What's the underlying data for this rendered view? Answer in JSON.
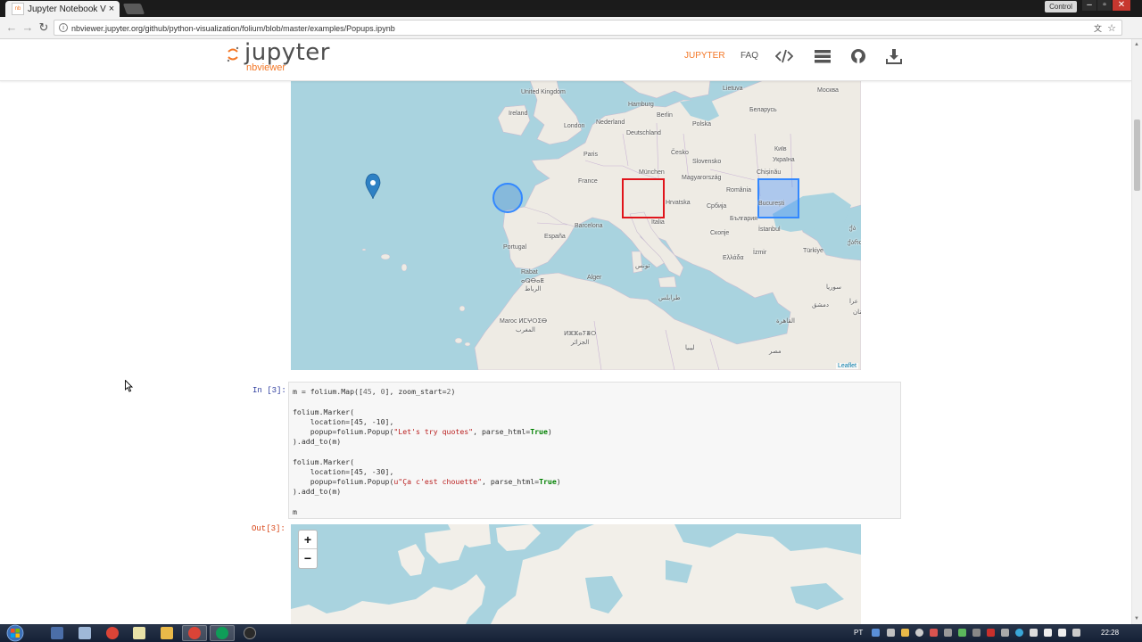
{
  "browser": {
    "tab_title": "Jupyter Notebook Viewer",
    "tab_favicon_text": "nb",
    "tab_close": "×",
    "profile_label": "Control",
    "url": "nbviewer.jupyter.org/github/python-visualization/folium/blob/master/examples/Popups.ipynb",
    "back_icon": "←",
    "forward_icon": "→",
    "reload_icon": "↻",
    "info_icon": "i",
    "translate_icon": "文",
    "star_icon": "☆",
    "win_minimize": "–",
    "win_maximize": "▫",
    "win_close": "✕"
  },
  "header": {
    "logo_word": "jupyter",
    "logo_sub": "nbviewer",
    "nav_jupyter": "JUPYTER",
    "nav_faq": "FAQ"
  },
  "map1": {
    "attribution": "Leaflet",
    "labels": [
      {
        "id": "uk",
        "text": "United Kingdom"
      },
      {
        "id": "ireland",
        "text": "Ireland"
      },
      {
        "id": "london",
        "text": "London"
      },
      {
        "id": "nederland",
        "text": "Nederland"
      },
      {
        "id": "hamburg",
        "text": "Hamburg"
      },
      {
        "id": "berlin",
        "text": "Berlin"
      },
      {
        "id": "polska",
        "text": "Polska"
      },
      {
        "id": "lietuva",
        "text": "Lietuva"
      },
      {
        "id": "belarus",
        "text": "Беларусь"
      },
      {
        "id": "moskva",
        "text": "Москва"
      },
      {
        "id": "deutschland",
        "text": "Deutschland"
      },
      {
        "id": "paris",
        "text": "Paris"
      },
      {
        "id": "cesko",
        "text": "Česko"
      },
      {
        "id": "kyiv",
        "text": "Київ"
      },
      {
        "id": "ukraina",
        "text": "Україна"
      },
      {
        "id": "slovensko",
        "text": "Slovensko"
      },
      {
        "id": "munchen",
        "text": "München"
      },
      {
        "id": "france",
        "text": "France"
      },
      {
        "id": "magyarorszag",
        "text": "Magyarország"
      },
      {
        "id": "chisinau",
        "text": "Chișinău"
      },
      {
        "id": "romania",
        "text": "România"
      },
      {
        "id": "hrvatska",
        "text": "Hrvatska"
      },
      {
        "id": "srbija",
        "text": "Србија"
      },
      {
        "id": "bucuresti",
        "text": "București"
      },
      {
        "id": "bulgaria",
        "text": "България"
      },
      {
        "id": "barcelona",
        "text": "Barcelona"
      },
      {
        "id": "italia",
        "text": "Italia"
      },
      {
        "id": "skopje",
        "text": "Скопје"
      },
      {
        "id": "istanbul",
        "text": "İstanbul"
      },
      {
        "id": "espana",
        "text": "España"
      },
      {
        "id": "portugal",
        "text": "Portugal"
      },
      {
        "id": "ellada",
        "text": "Ελλάδα"
      },
      {
        "id": "izmir",
        "text": "İzmir"
      },
      {
        "id": "turkiye",
        "text": "Türkiye"
      },
      {
        "id": "rabat",
        "text": "Rabat"
      },
      {
        "id": "rabat_tz",
        "text": "ⴰⵕⴱⴰⵟ"
      },
      {
        "id": "rabat_ar",
        "text": "الرباط"
      },
      {
        "id": "alger",
        "text": "Alger"
      },
      {
        "id": "tunis",
        "text": "تونس"
      },
      {
        "id": "tarabulus",
        "text": "طرابلس"
      },
      {
        "id": "maroc",
        "text": "Maroc ⵍⵎⵖⵔⵉⴱ"
      },
      {
        "id": "maghrib_ar",
        "text": "المغرب"
      },
      {
        "id": "dzayer",
        "text": "ⵍⵣⵣⴰⵢⴻⵔ"
      },
      {
        "id": "jazair_ar",
        "text": "الجزائر"
      },
      {
        "id": "libya",
        "text": "ليبيا"
      },
      {
        "id": "misr",
        "text": "مصر"
      },
      {
        "id": "cairo",
        "text": "القاهرة"
      },
      {
        "id": "dimashq",
        "text": "دمشق"
      },
      {
        "id": "suriya",
        "text": "سوريا"
      },
      {
        "id": "iraq",
        "text": "عرا"
      },
      {
        "id": "lubnan",
        "text": "لبنان"
      },
      {
        "id": "ozemi",
        "text": "ქართ"
      },
      {
        "id": "sakartvelo",
        "text": "ქა"
      }
    ]
  },
  "code_cell": {
    "prompt": "In [3]:",
    "lines": [
      "m = folium.Map([45, 0], zoom_start=2)",
      "",
      "folium.Marker(",
      "    location=[45, -10],",
      "    popup=folium.Popup(\"Let's try quotes\", parse_html=True)",
      ").add_to(m)",
      "",
      "folium.Marker(",
      "    location=[45, -30],",
      "    popup=folium.Popup(u\"Ça c'est chouette\", parse_html=True)",
      ").add_to(m)",
      "",
      "m"
    ]
  },
  "output_cell": {
    "prompt": "Out[3]:",
    "zoom_in": "+",
    "zoom_out": "−"
  },
  "taskbar": {
    "lang": "PT",
    "clock": "22:28"
  }
}
